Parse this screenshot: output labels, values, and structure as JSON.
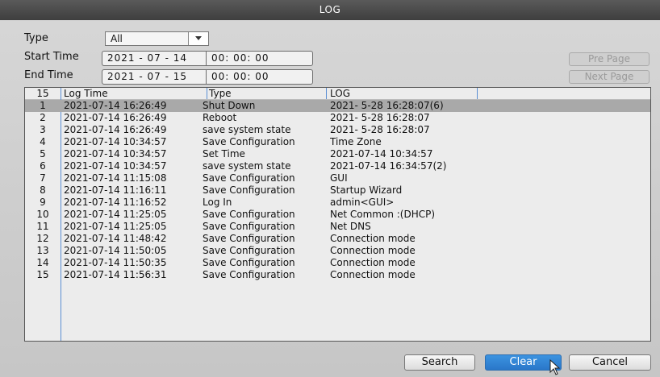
{
  "window": {
    "title": "LOG"
  },
  "filters": {
    "type_label": "Type",
    "type_value": "All",
    "start_label": "Start Time",
    "start_date": "2021 - 07 - 14",
    "start_time": "00: 00: 00",
    "end_label": "End Time",
    "end_date": "2021 - 07 - 15",
    "end_time": "00: 00: 00"
  },
  "paging": {
    "pre_page": "Pre Page",
    "next_page": "Next Page"
  },
  "table": {
    "count": "15",
    "columns": [
      "Log Time",
      "Type",
      "LOG"
    ],
    "selected_index": 0,
    "rows": [
      {
        "no": "1",
        "time": "2021-07-14 16:26:49",
        "type": "Shut Down",
        "log": "2021- 5-28 16:28:07(6)"
      },
      {
        "no": "2",
        "time": "2021-07-14 16:26:49",
        "type": "Reboot",
        "log": "2021- 5-28 16:28:07"
      },
      {
        "no": "3",
        "time": "2021-07-14 16:26:49",
        "type": "save system state",
        "log": "2021- 5-28 16:28:07"
      },
      {
        "no": "4",
        "time": "2021-07-14 10:34:57",
        "type": "Save Configuration",
        "log": "Time Zone"
      },
      {
        "no": "5",
        "time": "2021-07-14 10:34:57",
        "type": "Set Time",
        "log": "2021-07-14 10:34:57"
      },
      {
        "no": "6",
        "time": "2021-07-14 10:34:57",
        "type": "save system state",
        "log": "2021-07-14 16:34:57(2)"
      },
      {
        "no": "7",
        "time": "2021-07-14 11:15:08",
        "type": "Save Configuration",
        "log": "GUI"
      },
      {
        "no": "8",
        "time": "2021-07-14 11:16:11",
        "type": "Save Configuration",
        "log": "Startup Wizard"
      },
      {
        "no": "9",
        "time": "2021-07-14 11:16:52",
        "type": "Log In",
        "log": "admin<GUI>"
      },
      {
        "no": "10",
        "time": "2021-07-14 11:25:05",
        "type": "Save Configuration",
        "log": "Net Common :(DHCP)"
      },
      {
        "no": "11",
        "time": "2021-07-14 11:25:05",
        "type": "Save Configuration",
        "log": "Net DNS"
      },
      {
        "no": "12",
        "time": "2021-07-14 11:48:42",
        "type": "Save Configuration",
        "log": "Connection mode"
      },
      {
        "no": "13",
        "time": "2021-07-14 11:50:05",
        "type": "Save Configuration",
        "log": "Connection mode"
      },
      {
        "no": "14",
        "time": "2021-07-14 11:50:35",
        "type": "Save Configuration",
        "log": "Connection mode"
      },
      {
        "no": "15",
        "time": "2021-07-14 11:56:31",
        "type": "Save Configuration",
        "log": "Connection mode"
      }
    ]
  },
  "actions": {
    "search": "Search",
    "clear": "Clear",
    "cancel": "Cancel"
  },
  "colors": {
    "title_bar": "#4a4a4a",
    "accent": "#2f82d6",
    "selected_row": "#a9a9a9",
    "column_divider": "#5b8fd4"
  },
  "icons": {
    "dropdown": "chevron-down-icon",
    "pointer": "mouse-pointer-icon"
  }
}
